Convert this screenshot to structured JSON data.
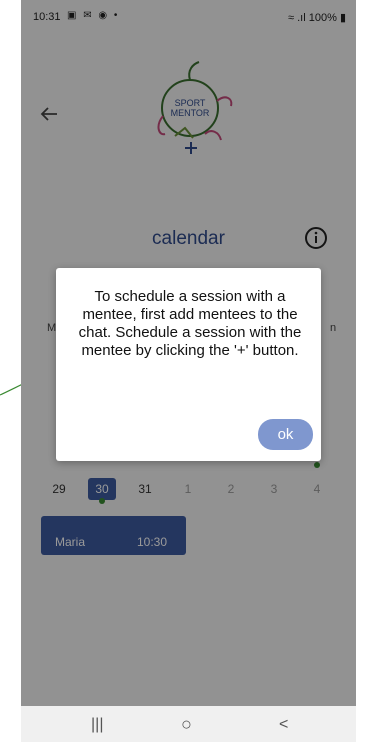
{
  "status": {
    "time": "10:31",
    "left_icons": "▣ ✉ ◉ •",
    "right_text": "100%"
  },
  "header": {
    "logo_text_1": "SPORT",
    "logo_text_2": "MENTOR",
    "title": "calendar"
  },
  "calendar": {
    "side_letters": [
      "M",
      "n"
    ],
    "days": [
      {
        "label": "29",
        "faded": false
      },
      {
        "label": "30",
        "faded": false,
        "selected": true
      },
      {
        "label": "31",
        "faded": false
      },
      {
        "label": "1",
        "faded": true
      },
      {
        "label": "2",
        "faded": true
      },
      {
        "label": "3",
        "faded": true
      },
      {
        "label": "4",
        "faded": true
      }
    ]
  },
  "event": {
    "name": "Maria",
    "time": "10:30"
  },
  "dialog": {
    "message": "To schedule a session with a mentee, first add mentees to the chat. Schedule a session with the mentee by clicking the '+' button.",
    "ok_label": "ok"
  },
  "navbar": {
    "recents": "|||",
    "home": "○",
    "back": "<"
  },
  "colors": {
    "accent": "#3c5a9e",
    "button": "#7f97cf",
    "dot": "#3a8a32"
  }
}
